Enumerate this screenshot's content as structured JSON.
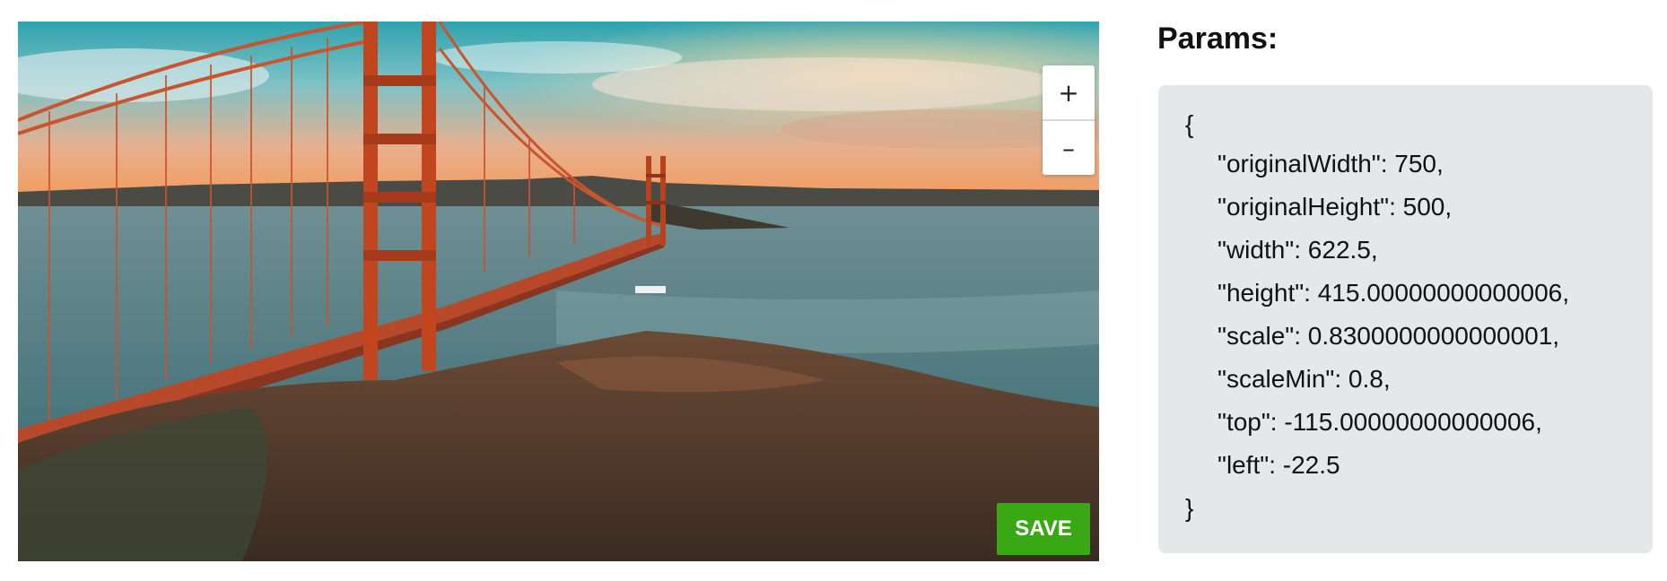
{
  "editor": {
    "image_alt": "Golden Gate Bridge at sunset viewed from a hill",
    "zoom_in_label": "+",
    "zoom_out_label": "–",
    "save_label": "SAVE"
  },
  "params": {
    "title": "Params:",
    "open_brace": "{",
    "close_brace": "}",
    "lines": [
      "\"originalWidth\": 750,",
      "\"originalHeight\": 500,",
      "\"width\": 622.5,",
      "\"height\": 415.00000000000006,",
      "\"scale\": 0.8300000000000001,",
      "\"scaleMin\": 0.8,",
      "\"top\": -115.00000000000006,",
      "\"left\": -22.5"
    ]
  }
}
